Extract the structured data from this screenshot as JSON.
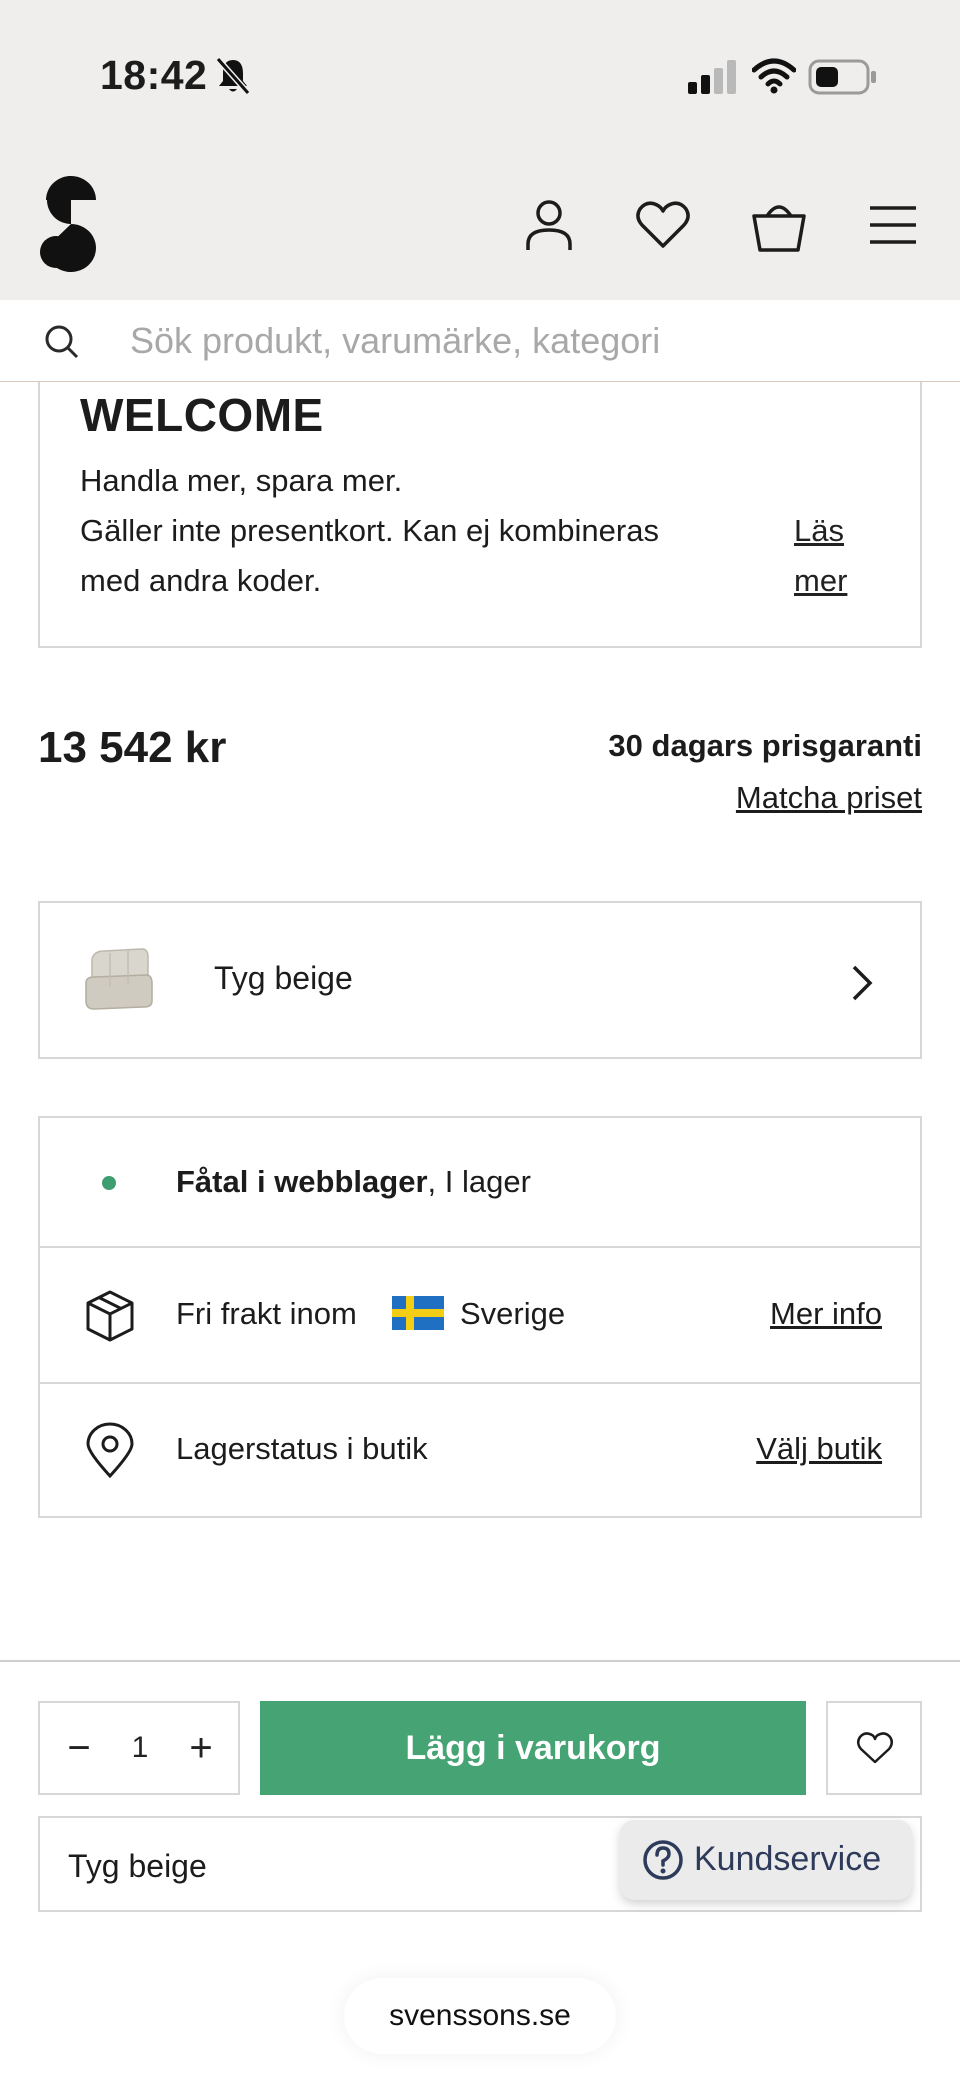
{
  "status_bar": {
    "time": "18:42"
  },
  "header": {
    "logo_icon": "svenssons-s-logo",
    "icons": [
      "account-icon",
      "heart-icon",
      "basket-icon",
      "menu-icon"
    ]
  },
  "search": {
    "placeholder": "Sök produkt, varumärke, kategori",
    "value": ""
  },
  "welcome": {
    "title": "WELCOME",
    "line1": "Handla mer, spara mer.",
    "line2": "Gäller inte presentkort. Kan ej kombineras",
    "line3": "med andra koder.",
    "read_more": "Läs mer"
  },
  "price": {
    "amount": "13 542 kr",
    "guarantee": "30 dagars prisgaranti",
    "match_link": "Matcha priset"
  },
  "variant": {
    "label": "Tyg beige"
  },
  "info": {
    "stock_bold": "Fåtal i webblager",
    "stock_rest": ", I lager",
    "stock_color": "#3f9e6f",
    "shipping_prefix": "Fri frakt inom",
    "shipping_country": "Sverige",
    "shipping_link": "Mer info",
    "store_label": "Lagerstatus i butik",
    "store_link": "Välj butik"
  },
  "cart": {
    "quantity": "1",
    "minus": "−",
    "plus": "+",
    "add_label": "Lägg i varukorg",
    "accent": "#46a374"
  },
  "variant_bar": {
    "label": "Tyg beige"
  },
  "support": {
    "label": "Kundservice"
  },
  "browser": {
    "url": "svenssons.se"
  }
}
